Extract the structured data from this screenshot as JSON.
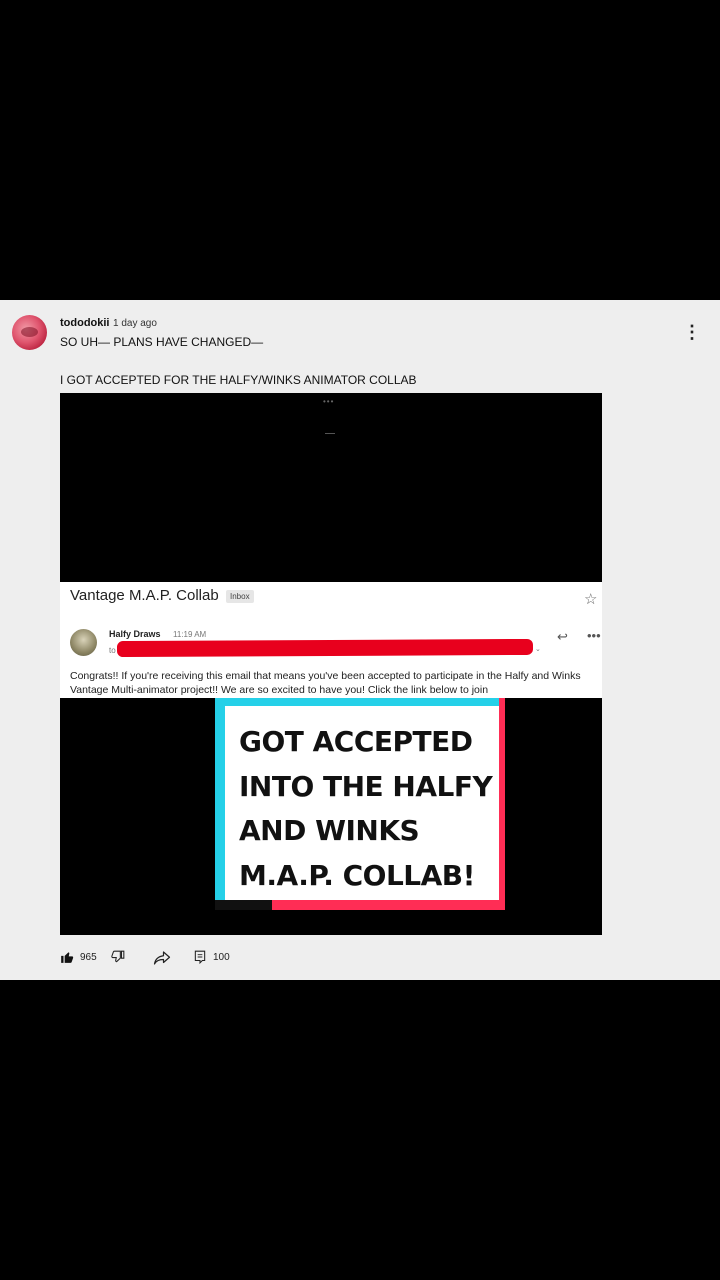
{
  "comment": {
    "username": "tododokii",
    "timestamp": "1 day ago",
    "line1": "SO UH— PLANS HAVE CHANGED—",
    "line2": "I GOT ACCEPTED FOR THE HALFY/WINKS ANIMATOR COLLAB"
  },
  "media": {
    "email": {
      "subject": "Vantage M.A.P. Collab",
      "badge": "Inbox",
      "sender": "Halfy Draws",
      "time": "11:19 AM",
      "to": "to",
      "body": "Congrats!! If you're receiving this email that means you've been accepted to participate in the Halfy and Winks Vantage Multi-animator project!! We are so excited to have you! Click the link below to join"
    },
    "card": {
      "text_lines": [
        "GOT ACCEPTED",
        "INTO THE HALFY",
        "AND WINKS",
        "M.A.P. COLLAB!"
      ]
    }
  },
  "actions": {
    "like_count": "965",
    "comment_count": "100"
  },
  "colors": {
    "panel_bg": "#eeeeee",
    "redaction": "#e8001d",
    "card_cyan": "#25d0e8",
    "card_pink": "#ff2d55"
  },
  "icons": [
    "avatar",
    "more-vert-icon",
    "star-icon",
    "reply-icon",
    "more-horiz-icon",
    "thumb-up-icon",
    "thumb-down-icon",
    "share-icon",
    "comment-icon"
  ]
}
